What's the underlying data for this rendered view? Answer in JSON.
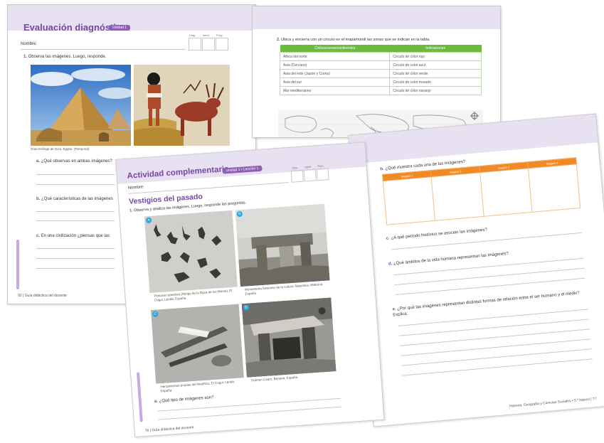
{
  "back_left": {
    "title": "Evaluación diagnóstica",
    "unit_tag": "Unidad 1",
    "eval_headers": [
      "Diag.",
      "Ident.",
      "Preg."
    ],
    "name_label": "Nombre:",
    "q1": "1.",
    "q1_text": "Observa las imágenes. Luego, responde.",
    "photo_caption": "Gran Esfinge de Giza, Egipto. (Temporal)",
    "qa": "a.",
    "qa_text": "¿Qué observas en ambas imágenes?",
    "qb": "b.",
    "qb_text": "¿Qué características de las imágenes",
    "qc": "c.",
    "qc_text": "En una civilización ¿piensas que las",
    "footer_num": "92",
    "footer_text": "Guía didáctica del docente"
  },
  "back_right": {
    "q2": "2.",
    "q2_text": "Ubica y encierra con un círculo en el mapamundi las zonas que se indican en la tabla.",
    "table_headers": [
      "Civilizaciones/continentes",
      "Indicaciones"
    ],
    "rows": [
      [
        "África del norte",
        "Círculo de color rojo"
      ],
      [
        "Asia (Cercano)",
        "Círculo de color azul"
      ],
      [
        "Asia del este (Japón y Corea)",
        "Círculo de color verde"
      ],
      [
        "Asia del sur",
        "Círculo de color morado"
      ],
      [
        "Mar mediterráneo",
        "Círculo de color naranjo"
      ]
    ]
  },
  "front_left": {
    "title": "Actividad complementaria",
    "unit_tag": "Unidad 1 • Lección 1",
    "eval_headers": [
      "Obs.",
      "Ident.",
      "Pers."
    ],
    "name_label": "Nombre:",
    "subtitle": "Vestigios del pasado",
    "q1": "1.",
    "q1_text": "Observa y analiza las imágenes. Luego, responde las preguntas.",
    "badges": [
      "A",
      "B",
      "C",
      "D"
    ],
    "captions": [
      "Pinturas rupestres (Abrigo de la Roca de los Moros), El Cogul, Lérida, España.",
      "Monumento funerario de la cultura Talayótica, Mallorca, España.",
      "Herramientas propias del Neolítico, El Cogul, Lérida, España.",
      "Dolmen Lixarri, Bertaria, España."
    ],
    "qa": "a.",
    "qa_text": "¿Qué tipo de imágenes son?",
    "footer_num": "76",
    "footer_text": "Guía didáctica del docente"
  },
  "front_right": {
    "qb": "b.",
    "qb_text": "¿Qué muestra cada una de las imágenes?",
    "table_headers": [
      "Imagen 1",
      "Imagen 2",
      "Imagen 3",
      "Imagen 4"
    ],
    "qc": "c.",
    "qc_text": "¿A qué período histórico se asocian las imágenes?",
    "qd": "d.",
    "qd_text": "¿Qué ámbitos de la vida humana representan las imágenes?",
    "qe": "e.",
    "qe_text": "¿Por qué las imágenes representan distintas formas de relación entre el ser humano y el medio? Explica.",
    "footer_text": "Historia, Geografía y Ciencias Sociales • 5.º básico",
    "footer_num": "77"
  },
  "colors": {
    "purple": "#7646a4",
    "lavender_band": "#e7e1f1",
    "green_header": "#6cbb3c",
    "orange_header": "#f08a24",
    "badge_blue": "#27a6df"
  }
}
